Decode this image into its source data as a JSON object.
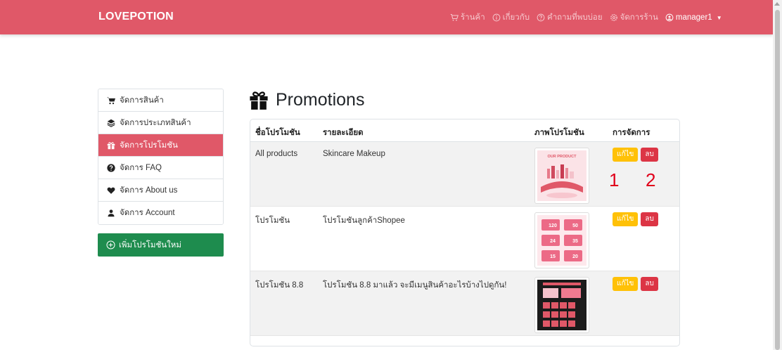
{
  "brand": "LOVEPOTION",
  "nav": {
    "shop": "ร้านค้า",
    "about": "เกี่ยวกับ",
    "faq": "คำถามที่พบบ่อย",
    "manage": "จัดการร้าน",
    "user": "manager1"
  },
  "sidebar": {
    "items": [
      {
        "label": "จัดการสินค้า",
        "icon": "cart-icon"
      },
      {
        "label": "จัดการประเภทสินค้า",
        "icon": "layers-icon"
      },
      {
        "label": "จัดการโปรโมชัน",
        "icon": "gift-icon"
      },
      {
        "label": "จัดการ FAQ",
        "icon": "question-circle-icon"
      },
      {
        "label": "จัดการ About us",
        "icon": "heart-icon"
      },
      {
        "label": "จัดการ Account",
        "icon": "user-icon"
      }
    ],
    "add_label": "เพิ่มโปรโมชันใหม่"
  },
  "page": {
    "title": "Promotions"
  },
  "table": {
    "headers": {
      "name": "ชื่อโปรโมชัน",
      "desc": "รายละเอียด",
      "image": "ภาพโปรโมชัน",
      "actions": "การจัดการ"
    },
    "rows": [
      {
        "name": "All products",
        "desc": "Skincare Makeup"
      },
      {
        "name": "โปรโมชัน",
        "desc": "โปรโมชันลูกค้าShopee"
      },
      {
        "name": "โปรโมชัน 8.8",
        "desc": "โปรโมชัน 8.8 มาแล้ว จะมีเมนูสินค้าอะไรบ้างไปดูกัน!"
      }
    ],
    "edit_label": "แก้ไข",
    "delete_label": "ลบ"
  },
  "annotations": {
    "one": "1",
    "two": "2"
  },
  "thumbs": {
    "row1_text": "OUR PRODUCT",
    "row2_codes": [
      "120",
      "50",
      "24",
      "35",
      "15",
      "20"
    ]
  },
  "colors": {
    "primary": "#e05868",
    "success": "#1e8c4e",
    "warning": "#ffc107",
    "danger": "#dc3545"
  }
}
